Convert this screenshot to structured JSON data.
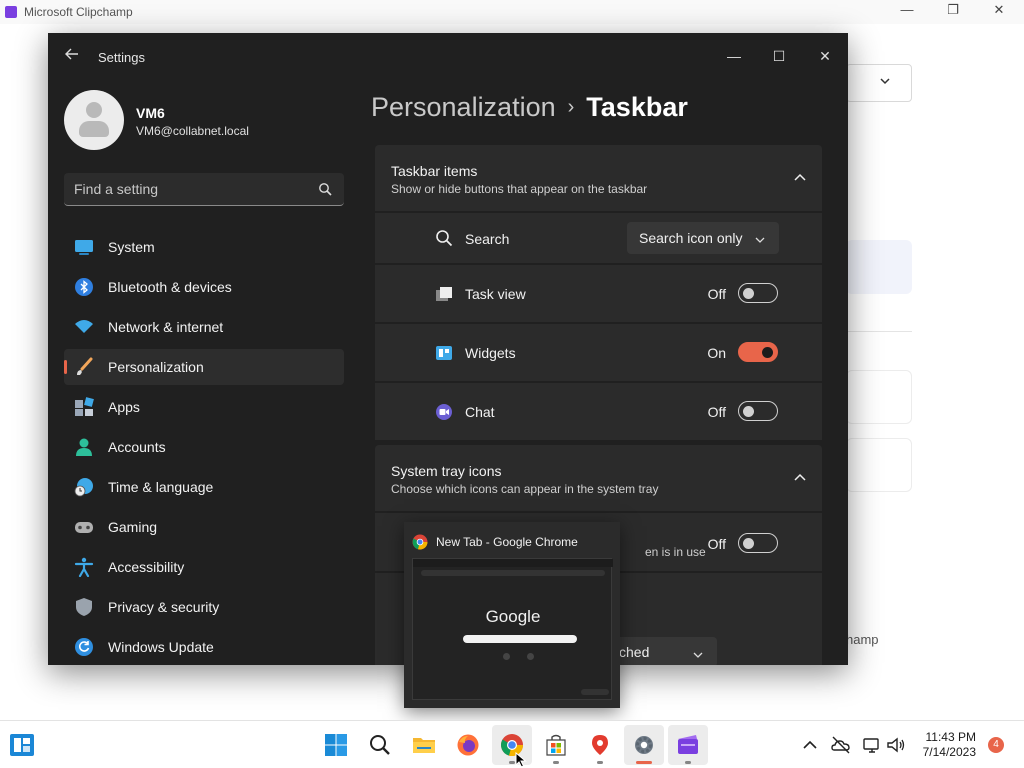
{
  "background_app": {
    "title": "Microsoft Clipchamp",
    "window_controls": {
      "minimize": "—",
      "maximize": "❐",
      "close": "✕"
    },
    "partial_text": "hamp"
  },
  "settings": {
    "title": "Settings",
    "window_controls": {
      "minimize": "—",
      "maximize": "☐",
      "close": "✕"
    },
    "profile": {
      "name": "VM6",
      "email": "VM6@collabnet.local"
    },
    "search": {
      "placeholder": "Find a setting"
    },
    "nav": [
      {
        "label": "System",
        "icon": "system-icon",
        "active": false
      },
      {
        "label": "Bluetooth & devices",
        "icon": "bluetooth-icon",
        "active": false
      },
      {
        "label": "Network & internet",
        "icon": "wifi-icon",
        "active": false
      },
      {
        "label": "Personalization",
        "icon": "brush-icon",
        "active": true
      },
      {
        "label": "Apps",
        "icon": "apps-icon",
        "active": false
      },
      {
        "label": "Accounts",
        "icon": "account-icon",
        "active": false
      },
      {
        "label": "Time & language",
        "icon": "clock-globe-icon",
        "active": false
      },
      {
        "label": "Gaming",
        "icon": "controller-icon",
        "active": false
      },
      {
        "label": "Accessibility",
        "icon": "accessibility-icon",
        "active": false
      },
      {
        "label": "Privacy & security",
        "icon": "shield-icon",
        "active": false
      },
      {
        "label": "Windows Update",
        "icon": "update-icon",
        "active": false
      }
    ],
    "breadcrumb": {
      "parent": "Personalization",
      "separator": "›",
      "current": "Taskbar"
    },
    "taskbar_items": {
      "title": "Taskbar items",
      "subtitle": "Show or hide buttons that appear on the taskbar",
      "rows": {
        "search": {
          "label": "Search",
          "value": "Search icon only"
        },
        "task_view": {
          "label": "Task view",
          "state": "Off",
          "on": false
        },
        "widgets": {
          "label": "Widgets",
          "state": "On",
          "on": true
        },
        "chat": {
          "label": "Chat",
          "state": "Off",
          "on": false
        }
      }
    },
    "system_tray": {
      "title": "System tray icons",
      "subtitle": "Choose which icons can appear in the system tray",
      "pen_row": {
        "label_fragment": "en is in use",
        "state": "Off",
        "on": false
      },
      "select_fragment": "ched"
    }
  },
  "preview": {
    "title": "New Tab - Google Chrome",
    "logo_text": "Google"
  },
  "taskbar": {
    "apps": [
      "start-icon",
      "search-icon",
      "file-explorer-icon",
      "firefox-icon",
      "chrome-icon",
      "store-icon",
      "maps-icon",
      "settings-icon",
      "clipchamp-icon"
    ],
    "clock": {
      "time": "11:43 PM",
      "date": "7/14/2023"
    },
    "notification_count": "4"
  },
  "colors": {
    "accent": "#e8654a",
    "settings_bg": "#202020",
    "card_bg": "#2b2b2b"
  }
}
